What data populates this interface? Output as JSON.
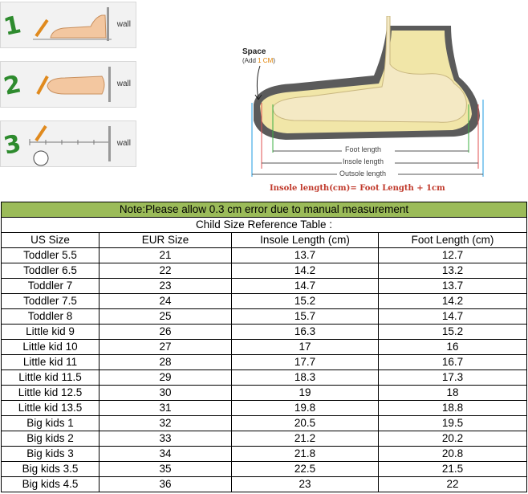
{
  "illustration": {
    "steps": [
      {
        "number": "1",
        "wall_label": "wall"
      },
      {
        "number": "2",
        "wall_label": "wall"
      },
      {
        "number": "3",
        "wall_label": "wall"
      }
    ],
    "space_title": "Space",
    "space_sub_prefix": "(Add ",
    "space_sub_highlight": "1 CM",
    "space_sub_suffix": ")",
    "foot_length_label": "Foot length",
    "insole_length_label": "Insole length",
    "outsole_length_label": "Outsole length",
    "formula": "Insole length(cm)= Foot Length + 1cm"
  },
  "note": "Note:Please allow 0.3 cm error due to manual measurement",
  "table_title": "Child Size Reference Table :",
  "columns": [
    "US Size",
    "EUR Size",
    "Insole Length (cm)",
    "Foot Length (cm)"
  ],
  "rows": [
    [
      "Toddler 5.5",
      "21",
      "13.7",
      "12.7"
    ],
    [
      "Toddler 6.5",
      "22",
      "14.2",
      "13.2"
    ],
    [
      "Toddler 7",
      "23",
      "14.7",
      "13.7"
    ],
    [
      "Toddler 7.5",
      "24",
      "15.2",
      "14.2"
    ],
    [
      "Toddler 8",
      "25",
      "15.7",
      "14.7"
    ],
    [
      "Little kid 9",
      "26",
      "16.3",
      "15.2"
    ],
    [
      "Little kid 10",
      "27",
      "17",
      "16"
    ],
    [
      "Little kid 11",
      "28",
      "17.7",
      "16.7"
    ],
    [
      "Little kid 11.5",
      "29",
      "18.3",
      "17.3"
    ],
    [
      "Little kid 12.5",
      "30",
      "19",
      "18"
    ],
    [
      "Little kid 13.5",
      "31",
      "19.8",
      "18.8"
    ],
    [
      "Big kids 1",
      "32",
      "20.5",
      "19.5"
    ],
    [
      "Big kids 2",
      "33",
      "21.2",
      "20.2"
    ],
    [
      "Big kids 3",
      "34",
      "21.8",
      "20.8"
    ],
    [
      "Big kids 3.5",
      "35",
      "22.5",
      "21.5"
    ],
    [
      "Big kids 4.5",
      "36",
      "23",
      "22"
    ]
  ]
}
